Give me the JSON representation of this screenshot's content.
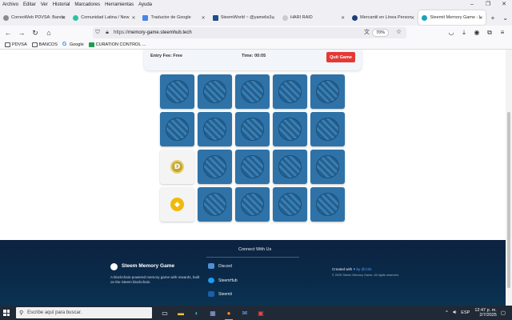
{
  "menu": [
    "Archivo",
    "Editar",
    "Ver",
    "Historial",
    "Marcadores",
    "Herramientas",
    "Ayuda"
  ],
  "window_controls": [
    "–",
    "❐",
    "✕"
  ],
  "tabs": [
    {
      "label": "CorreoWeb PDVSA: Bande",
      "color": "#8a8a8a",
      "active": false
    },
    {
      "label": "Comunidad Latina / New",
      "color": "#27c4a0",
      "active": false
    },
    {
      "label": "Traductor de Google",
      "color": "#4a86e8",
      "active": false
    },
    {
      "label": "SteemWorld ~ @yamelis3",
      "color": "#1e4f8a",
      "active": false
    },
    {
      "label": "HARI RAID",
      "color": "#cccccc",
      "active": false
    },
    {
      "label": "Mercantil en Línea Person",
      "color": "#1c3f7a",
      "active": false
    },
    {
      "label": "Steemit Memory Game - L",
      "color": "#1ba3bd",
      "active": true
    }
  ],
  "tab_controls": {
    "new_tab": "+",
    "list_tabs": "⌄"
  },
  "nav": {
    "back": "←",
    "forward": "→",
    "reload": "↻",
    "home": "⌂"
  },
  "url": {
    "prefix": "https://",
    "domain": "memory-game.steemhub.tech",
    "zoom": "70%"
  },
  "bookmarks": [
    {
      "label": "PDVSA",
      "type": "folder"
    },
    {
      "label": "BANCOS",
      "type": "folder"
    },
    {
      "label": "Google",
      "type": "google"
    },
    {
      "label": "CURATION CONTROL ...",
      "type": "green"
    }
  ],
  "game": {
    "entry_fee": "Entry Fee: Free",
    "time": "Time: 00:05",
    "quit_label": "Quit Game"
  },
  "board": {
    "cells": [
      "hidden",
      "hidden",
      "hidden",
      "hidden",
      "hidden",
      "hidden",
      "hidden",
      "hidden",
      "hidden",
      "hidden",
      "doge",
      "hidden",
      "hidden",
      "hidden",
      "hidden",
      "bnb",
      "hidden",
      "hidden",
      "hidden",
      "hidden"
    ],
    "symbols": {
      "doge": "Ð",
      "bnb": "◆"
    }
  },
  "footer": {
    "brand": "Steem Memory Game",
    "description": "A blockchain-powered memory game with rewards, built on the Steem blockchain.",
    "connect_title": "Connect With Us",
    "social": [
      "Discord",
      "SteemHub",
      "Steemit"
    ],
    "created_prefix": "Created with",
    "created_by": "by @ lofo",
    "copyright": "© 2025 Steem Memory Game. All rights reserved."
  },
  "taskbar": {
    "search_placeholder": "Escribe aquí para buscar.",
    "lang": "ESP",
    "time": "12:47 p. m.",
    "date": "2/7/2025"
  },
  "colors": {
    "accent": "#2f72a7",
    "quit": "#e53935",
    "footer": "#0a2a4a"
  }
}
